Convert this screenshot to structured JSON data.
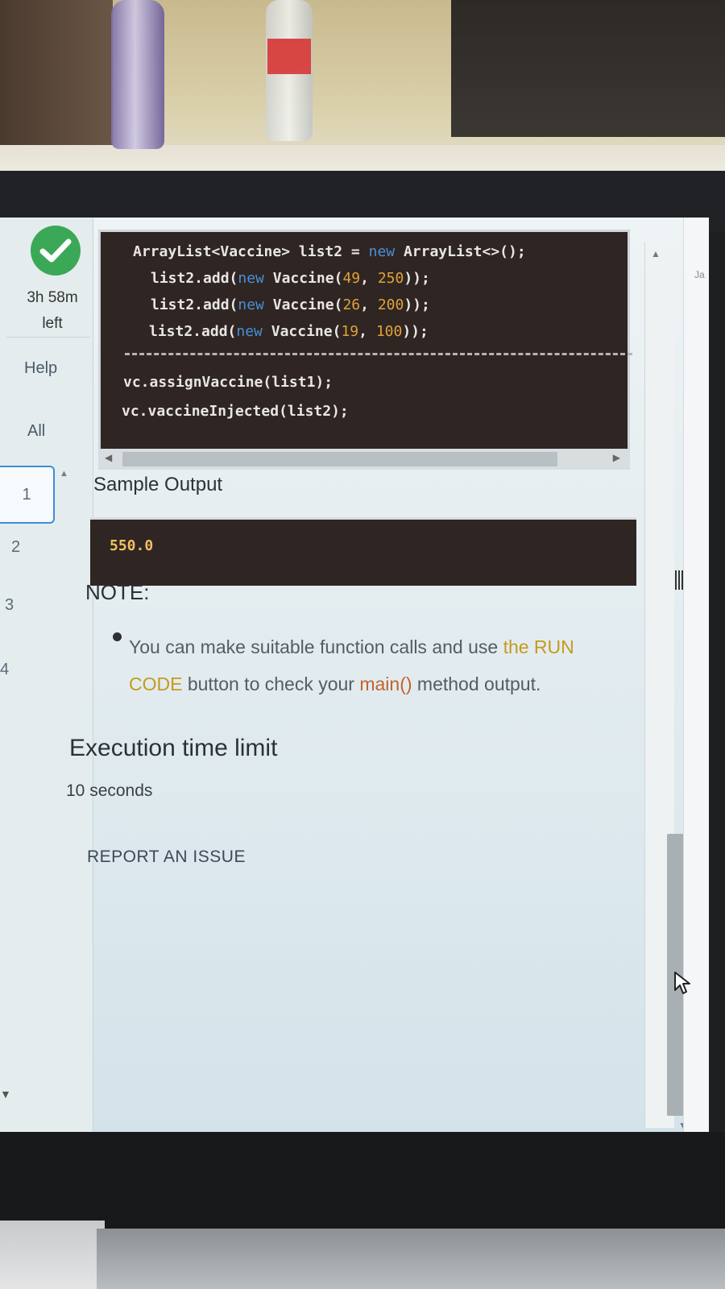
{
  "status": {
    "complete_icon": "check-circle-icon",
    "time_left": "3h 58m left"
  },
  "sidebar": {
    "help_label": "Help",
    "all_label": "All",
    "questions": [
      "1",
      "2",
      "3",
      "4"
    ],
    "active_question": "1"
  },
  "code_example": {
    "lines": [
      "ArrayList<Vaccine> list2 = new ArrayList<>();",
      "list2.add(new Vaccine(49, 250));",
      "list2.add(new Vaccine(26, 200));",
      "list2.add(new Vaccine(19, 100));",
      "vc.assignVaccine(list1);",
      "vc.vaccineInjected(list2);"
    ]
  },
  "sample_output": {
    "title": "Sample Output",
    "value": "550.0"
  },
  "note": {
    "title": "NOTE:",
    "text_before": "You can make suitable function calls and use ",
    "highlight_1": "the RUN CODE",
    "text_middle": " button to check your ",
    "highlight_2": "main()",
    "text_after": " method output."
  },
  "execution": {
    "title": "Execution time limit",
    "value": "10 seconds"
  },
  "report_button": "REPORT AN ISSUE",
  "editor_hint": "Ja",
  "colors": {
    "success": "#3aa856",
    "code_bg": "#2f2523",
    "keyword": "#4a8fd6",
    "number": "#e0a23a",
    "output_text": "#f0c060",
    "highlight_yellow": "#c69a1d",
    "highlight_orange": "#c4622a"
  }
}
